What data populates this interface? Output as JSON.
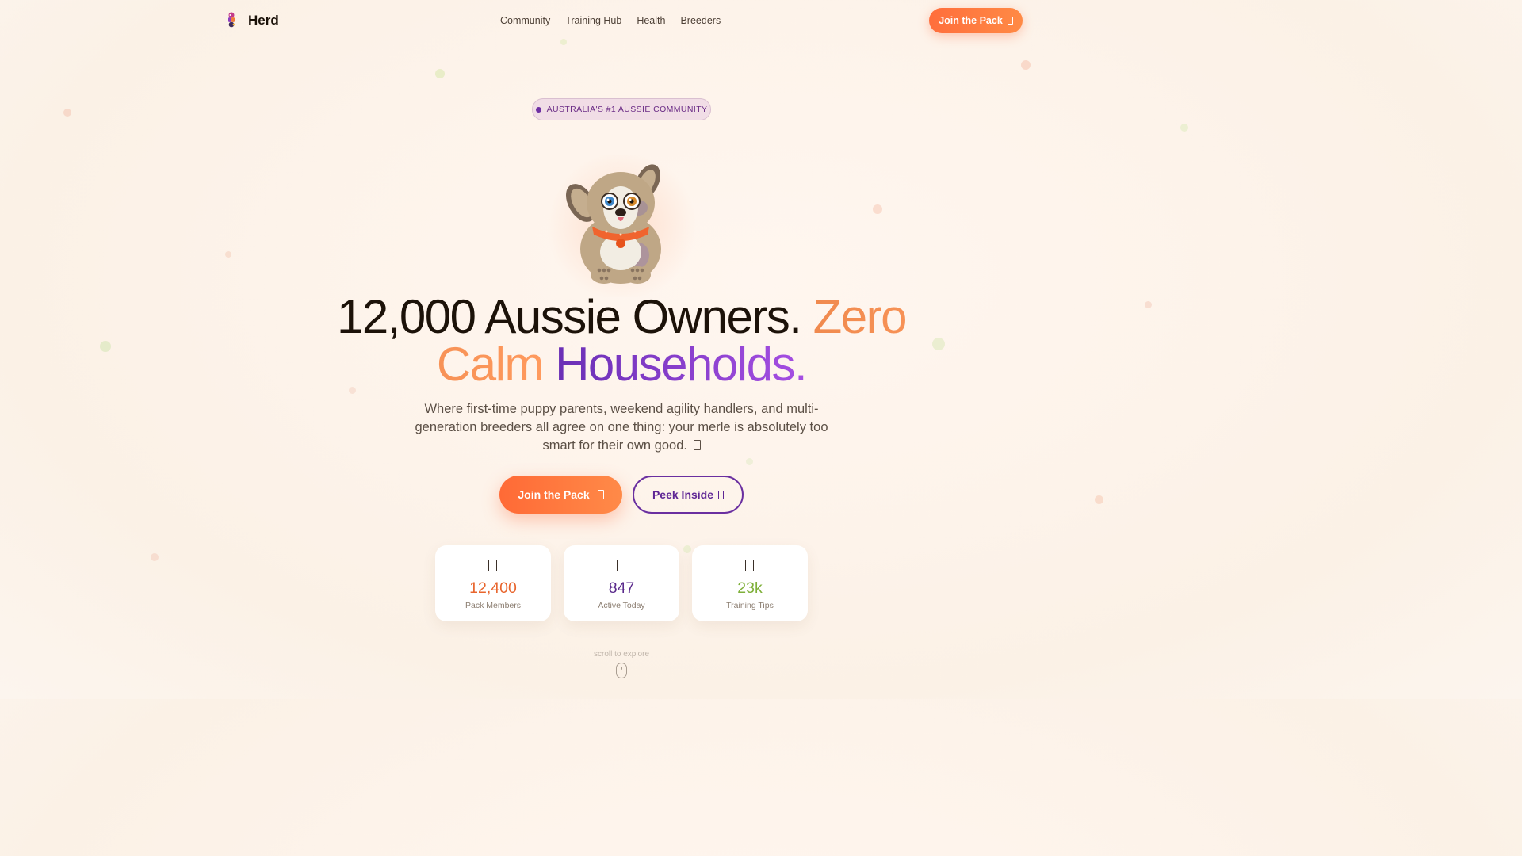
{
  "nav": {
    "brand": "Herd",
    "links": [
      "Community",
      "Training Hub",
      "Health",
      "Breeders"
    ],
    "cta_label": "Join the Pack"
  },
  "hero": {
    "badge": "AUSTRALIA'S #1 AUSSIE COMMUNITY",
    "headline": {
      "part1": "12,000 Aussie Owners.",
      "part2": "Zero Calm",
      "part3": "Households."
    },
    "subtitle": "Where first-time puppy parents, weekend agility handlers, and multi-generation breeders all agree on one thing: your merle is absolutely too smart for their own good.",
    "primary_cta": "Join the Pack",
    "secondary_cta": "Peek Inside"
  },
  "stats": [
    {
      "value": "12,400",
      "label": "Pack Members",
      "color": "#e8652d"
    },
    {
      "value": "847",
      "label": "Active Today",
      "color": "#5a2a8c"
    },
    {
      "value": "23k",
      "label": "Training Tips",
      "color": "#7fb03a"
    }
  ],
  "scroll_hint": "scroll to explore",
  "colors": {
    "accent_orange": "#ff7a3c",
    "accent_purple": "#6a2fa0",
    "accent_green": "#7fb03a"
  },
  "icons": {
    "logo": "multicolor-dog-logo",
    "placeholder_glyph": "missing-glyph-box",
    "scroll": "mouse-icon"
  }
}
